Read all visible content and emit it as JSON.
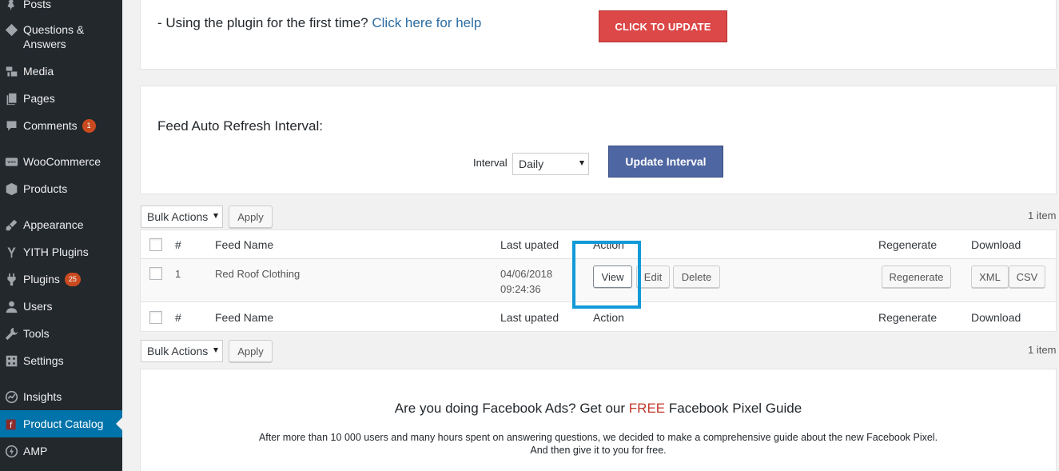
{
  "sidebar": {
    "items": [
      {
        "label": "Posts",
        "icon": "pin-icon"
      },
      {
        "label": "Questions &",
        "label2": "Answers",
        "icon": "tag-icon"
      },
      {
        "label": "Media",
        "icon": "media-icon"
      },
      {
        "label": "Pages",
        "icon": "pages-icon"
      },
      {
        "label": "Comments",
        "icon": "comments-icon",
        "badge": "1"
      },
      {
        "label": "WooCommerce",
        "icon": "woo-icon"
      },
      {
        "label": "Products",
        "icon": "box-icon"
      },
      {
        "label": "Appearance",
        "icon": "brush-icon"
      },
      {
        "label": "YITH Plugins",
        "icon": "yith-icon"
      },
      {
        "label": "Plugins",
        "icon": "plug-icon",
        "badge": "25"
      },
      {
        "label": "Users",
        "icon": "user-icon"
      },
      {
        "label": "Tools",
        "icon": "wrench-icon"
      },
      {
        "label": "Settings",
        "icon": "settings-icon"
      },
      {
        "label": "Insights",
        "icon": "insights-icon"
      },
      {
        "label": "Product Catalog",
        "icon": "catalog-icon"
      },
      {
        "label": "AMP",
        "icon": "amp-icon"
      }
    ],
    "colors": {
      "bg": "#23282d",
      "active": "#0073aa",
      "badge": "#ca4a1f"
    }
  },
  "update_box": {
    "prefix": "- Using the plugin for the first time?",
    "help_link": "Click here for help",
    "update_button": "CLICK TO UPDATE"
  },
  "interval_box": {
    "title": "Feed Auto Refresh Interval:",
    "interval_label": "Interval",
    "interval_value": "Daily",
    "update_button": "Update Interval"
  },
  "bulk_top": {
    "select": "Bulk Actions",
    "apply": "Apply",
    "count": "1 item"
  },
  "bulk_bottom": {
    "select": "Bulk Actions",
    "apply": "Apply",
    "count": "1 item"
  },
  "table": {
    "columns": {
      "num": "#",
      "name": "Feed Name",
      "updated": "Last upated",
      "action": "Action",
      "regenerate": "Regenerate",
      "download": "Download"
    },
    "rows": [
      {
        "num": "1",
        "name": "Red Roof Clothing",
        "date": "04/06/2018",
        "time": "09:24:36",
        "view": "View",
        "edit": "Edit",
        "delete": "Delete",
        "regenerate": "Regenerate",
        "xml": "XML",
        "csv": "CSV"
      }
    ]
  },
  "promo": {
    "title_before": "Are you doing Facebook Ads? Get our",
    "title_highlight": "FREE",
    "title_after": "Facebook Pixel Guide",
    "line1": "After more than 10 000 users and many hours spent on answering questions, we decided to make a comprehensive guide about the new Facebook Pixel.",
    "line2": "And then give it to you for free."
  }
}
